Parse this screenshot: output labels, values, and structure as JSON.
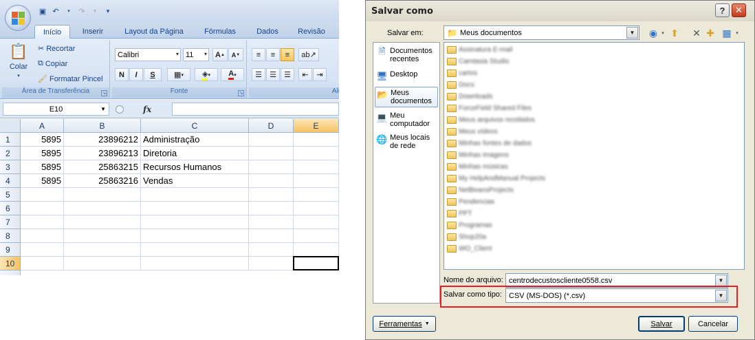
{
  "excel": {
    "ribbon_tabs": [
      "Início",
      "Inserir",
      "Layout da Página",
      "Fórmulas",
      "Dados",
      "Revisão"
    ],
    "active_tab": "Início",
    "clipboard": {
      "paste_label": "Colar",
      "cut_label": "Recortar",
      "copy_label": "Copiar",
      "format_painter_label": "Formatar Pincel",
      "group_label": "Área de Transferência"
    },
    "font": {
      "font_name": "Calibri",
      "font_size": "11",
      "bold": "N",
      "italic": "I",
      "underline": "S",
      "group_label": "Fonte"
    },
    "alignment_group_label_partial": "Ali",
    "name_box": "E10",
    "fx_symbol": "fx",
    "columns": [
      "A",
      "B",
      "C",
      "D",
      "E"
    ],
    "selected_column": "E",
    "rows": [
      {
        "num": "1",
        "A": "5895",
        "B": "23896212",
        "C": "Administração"
      },
      {
        "num": "2",
        "A": "5895",
        "B": "23896213",
        "C": "Diretoria"
      },
      {
        "num": "3",
        "A": "5895",
        "B": "25863215",
        "C": "Recursos Humanos"
      },
      {
        "num": "4",
        "A": "5895",
        "B": "25863216",
        "C": "Vendas"
      },
      {
        "num": "5",
        "A": "",
        "B": "",
        "C": ""
      },
      {
        "num": "6",
        "A": "",
        "B": "",
        "C": ""
      },
      {
        "num": "7",
        "A": "",
        "B": "",
        "C": ""
      },
      {
        "num": "8",
        "A": "",
        "B": "",
        "C": ""
      },
      {
        "num": "9",
        "A": "",
        "B": "",
        "C": ""
      },
      {
        "num": "10",
        "A": "",
        "B": "",
        "C": ""
      }
    ],
    "selected_row": "10"
  },
  "dialog": {
    "title": "Salvar como",
    "save_in_label": "Salvar em:",
    "save_in_value": "Meus documentos",
    "places": [
      {
        "label": "Documentos recentes",
        "icon": "recent-documents-icon"
      },
      {
        "label": "Desktop",
        "icon": "desktop-icon"
      },
      {
        "label": "Meus documentos",
        "icon": "my-documents-icon"
      },
      {
        "label": "Meu computador",
        "icon": "my-computer-icon"
      },
      {
        "label": "Meus locais de rede",
        "icon": "network-places-icon"
      }
    ],
    "selected_place": "Meus documentos",
    "folders": [
      "Assinatura E-mail",
      "Camtasia Studio",
      "cartos",
      "Docs",
      "Downloads",
      "ForceField Shared Files",
      "Meus arquivos recebidos",
      "Meus vídeos",
      "Minhas fontes de dados",
      "Minhas imagens",
      "Minhas músicas",
      "My HelpAndManual Projects",
      "NetBeansProjects",
      "Pendencias",
      "PPT",
      "Programas",
      "Shop20a",
      "WO_Client"
    ],
    "filename_label": "Nome do arquivo:",
    "filename_value": "centrodecustoscliente0558.csv",
    "filetype_label": "Salvar como tipo:",
    "filetype_value": "CSV (MS-DOS) (*.csv)",
    "tools_label": "Ferramentas",
    "save_label": "Salvar",
    "cancel_label": "Cancelar"
  }
}
